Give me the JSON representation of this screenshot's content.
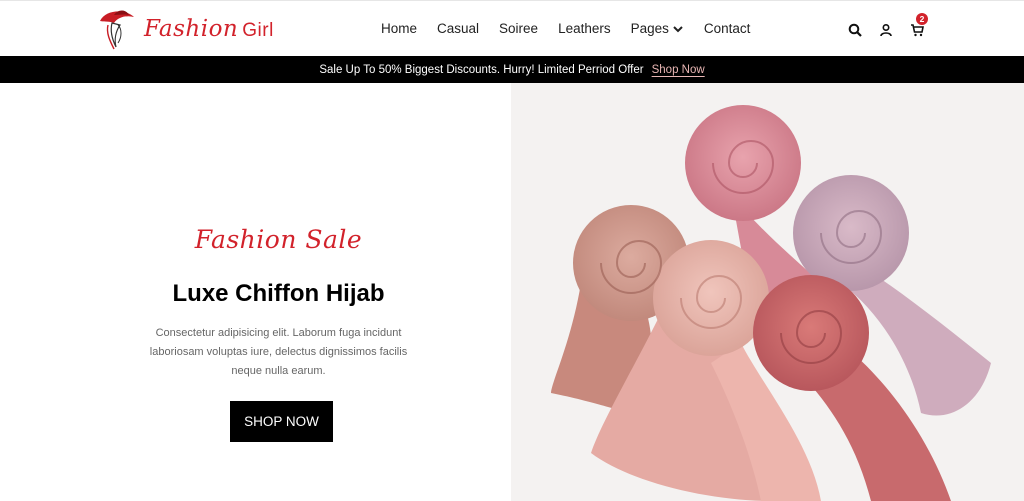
{
  "brand": {
    "name_script": "Fashion",
    "name_plain": "Girl"
  },
  "nav": {
    "items": [
      "Home",
      "Casual",
      "Soiree",
      "Leathers",
      "Pages",
      "Contact"
    ]
  },
  "tools": {
    "cart_count": "2"
  },
  "announcement": {
    "text": "Sale Up To 50% Biggest Discounts. Hurry! Limited Perriod Offer",
    "link": "Shop Now"
  },
  "hero": {
    "script_title": "Fashion Sale",
    "title": "Luxe Chiffon Hijab",
    "description": "Consectetur adipisicing elit. Laborum fuga incidunt laboriosam voluptas iure, delectus dignissimos facilis neque nulla earum.",
    "button": "SHOP NOW"
  },
  "colors": {
    "accent": "#d2222b",
    "bar_bg": "#000000",
    "link": "#e8b6b4"
  },
  "icons": [
    "logo-woman-hat-icon",
    "chevron-down-icon",
    "search-icon",
    "user-icon",
    "cart-icon"
  ]
}
